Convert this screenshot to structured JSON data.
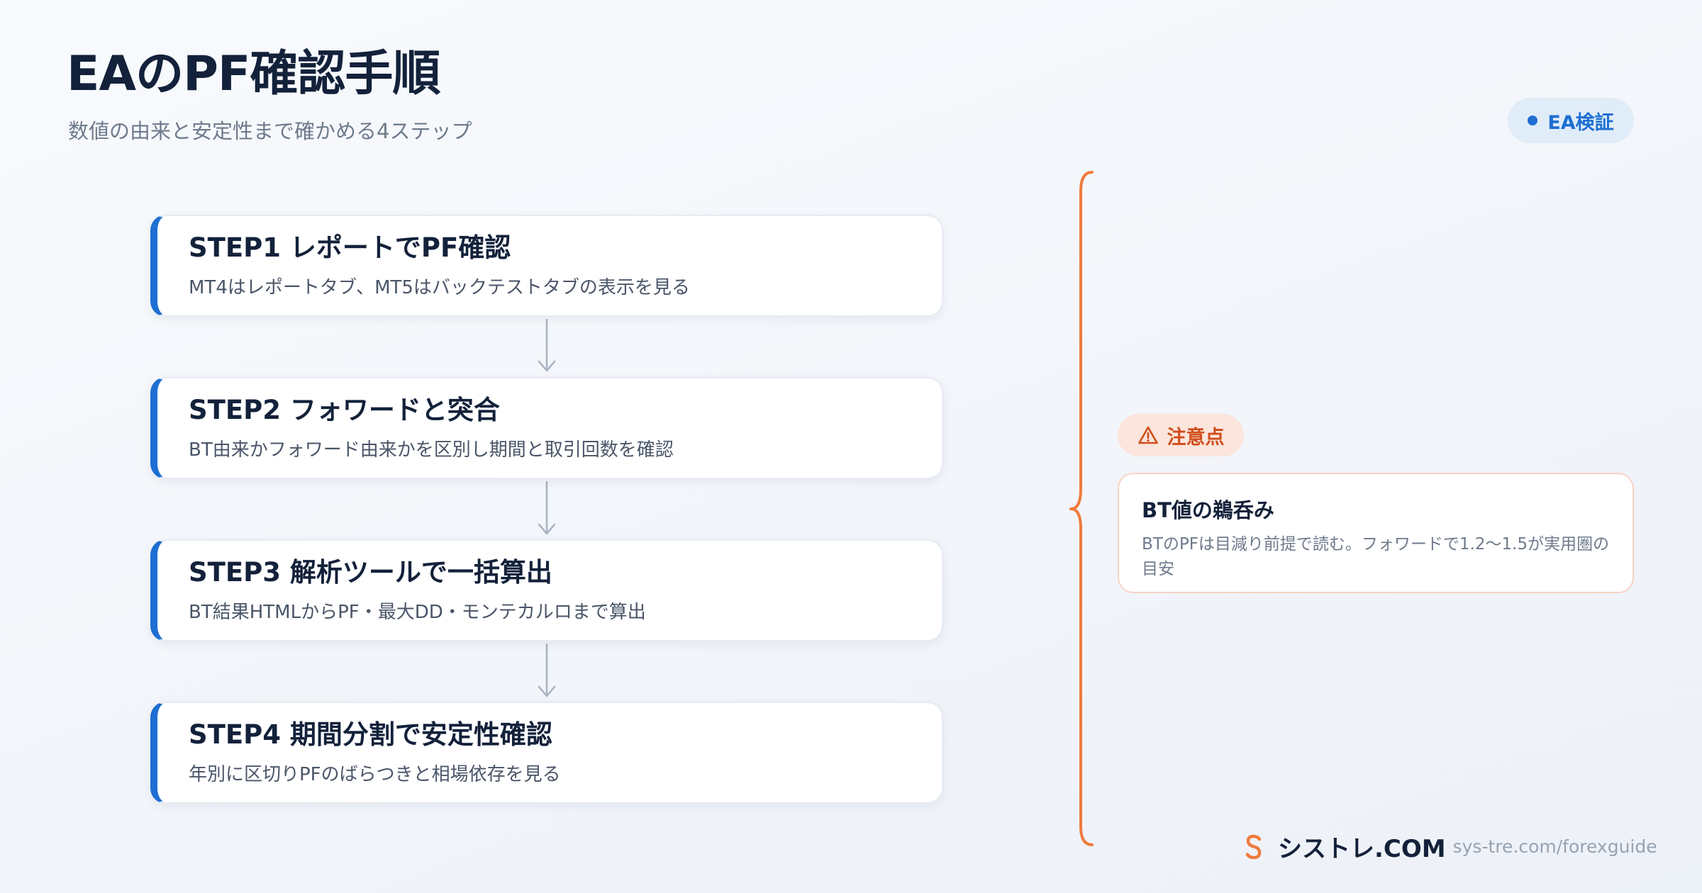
{
  "header": {
    "title": "EAのPF確認手順",
    "subtitle": "数値の由来と安定性まで確かめる4ステップ"
  },
  "badge": {
    "label": "EA検証"
  },
  "steps": [
    {
      "title": "STEP1 レポートでPF確認",
      "description": "MT4はレポートタブ、MT5はバックテストタブの表示を見る"
    },
    {
      "title": "STEP2 フォワードと突合",
      "description": "BT由来かフォワード由来かを区別し期間と取引回数を確認"
    },
    {
      "title": "STEP3 解析ツールで一括算出",
      "description": "BT結果HTMLからPF・最大DD・モンテカルロまで算出"
    },
    {
      "title": "STEP4 期間分割で安定性確認",
      "description": "年別に区切りPFのばらつきと相場依存を見る"
    }
  ],
  "caution": {
    "label": "注意点",
    "title": "BT値の鵜呑み",
    "text": "BTのPFは目減り前提で読む。フォワードで1.2〜1.5が実用圏の目安"
  },
  "footer": {
    "brand": "シストレ.COM",
    "url": "sys-tre.com/forexguide"
  },
  "colors": {
    "accent": "#1e6fd2",
    "caution": "#d04d1a",
    "bracket": "#f07a3c",
    "connector": "#a7b2c2"
  },
  "icons": {
    "badge": "dot-icon",
    "caution": "warning-triangle-icon",
    "brand": "s-logo-icon",
    "connector": "arrow-down-icon"
  }
}
